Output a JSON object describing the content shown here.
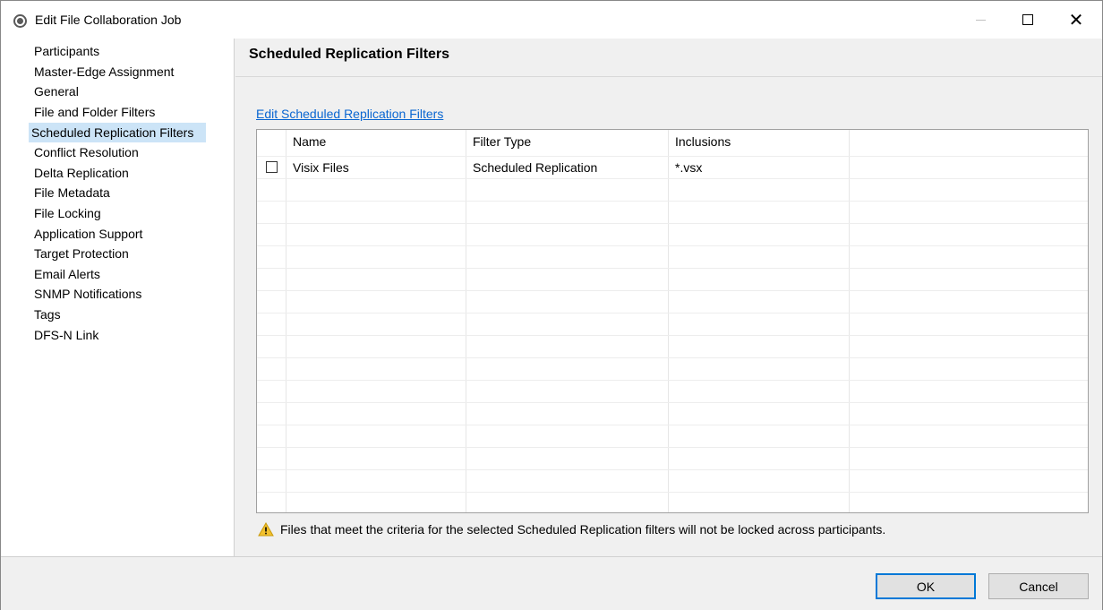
{
  "window": {
    "title": "Edit File Collaboration Job",
    "icon": "peer-app-icon",
    "controls": {
      "minimize": "minimize-icon",
      "maximize": "maximize-icon",
      "close": "✕"
    }
  },
  "sidebar": {
    "items": [
      {
        "label": "Participants"
      },
      {
        "label": "Master-Edge Assignment"
      },
      {
        "label": "General"
      },
      {
        "label": "File and Folder Filters"
      },
      {
        "label": "Scheduled Replication Filters"
      },
      {
        "label": "Conflict Resolution"
      },
      {
        "label": "Delta Replication"
      },
      {
        "label": "File Metadata"
      },
      {
        "label": "File Locking"
      },
      {
        "label": "Application Support"
      },
      {
        "label": "Target Protection"
      },
      {
        "label": "Email Alerts"
      },
      {
        "label": "SNMP Notifications"
      },
      {
        "label": "Tags"
      },
      {
        "label": "DFS-N Link"
      }
    ],
    "selected_index": 4
  },
  "main": {
    "title": "Scheduled Replication Filters",
    "edit_link": "Edit Scheduled Replication Filters",
    "table": {
      "columns": [
        "Name",
        "Filter Type",
        "Inclusions"
      ],
      "rows": [
        {
          "checked": false,
          "name": "Visix Files",
          "filter_type": "Scheduled Replication",
          "inclusions": "*.vsx"
        }
      ]
    },
    "warning": "Files that meet the criteria for the selected Scheduled Replication filters will not be locked across participants.",
    "warning_icon": "warning-icon"
  },
  "footer": {
    "ok_label": "OK",
    "cancel_label": "Cancel"
  },
  "colors": {
    "accent": "#0078d7",
    "link": "#0a66d1",
    "selection": "#cce4f7",
    "warning": "#f2c12e"
  }
}
